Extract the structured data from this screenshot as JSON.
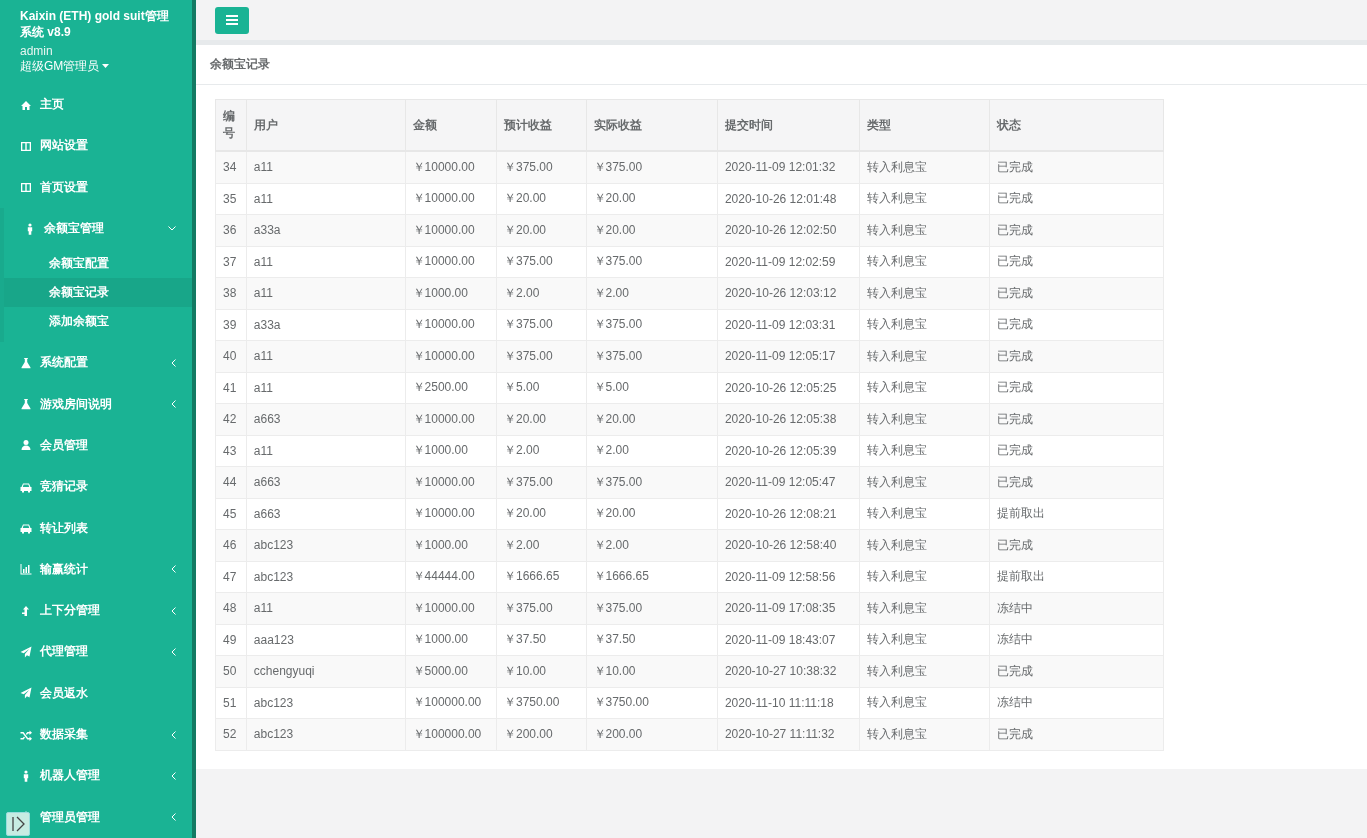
{
  "sidebar": {
    "title": "Kaixin (ETH) gold suit管理系统 v8.9",
    "user": "admin",
    "role": "超级GM管理员",
    "items": [
      {
        "label": "主页"
      },
      {
        "label": "网站设置"
      },
      {
        "label": "首页设置"
      },
      {
        "label": "余额宝管理",
        "expanded": true,
        "children": [
          {
            "label": "余额宝配置",
            "selected": false
          },
          {
            "label": "余额宝记录",
            "selected": true
          },
          {
            "label": "添加余额宝",
            "selected": false
          }
        ]
      },
      {
        "label": "系统配置",
        "expanded": false
      },
      {
        "label": "游戏房间说明",
        "expanded": false
      },
      {
        "label": "会员管理"
      },
      {
        "label": "竞猜记录"
      },
      {
        "label": "转让列表"
      },
      {
        "label": "输赢统计",
        "expanded": false
      },
      {
        "label": "上下分管理",
        "expanded": false
      },
      {
        "label": "代理管理",
        "expanded": false
      },
      {
        "label": "会员返水"
      },
      {
        "label": "数据采集",
        "expanded": false
      },
      {
        "label": "机器人管理",
        "expanded": false
      },
      {
        "label": "管理员管理",
        "expanded": false
      }
    ]
  },
  "panel": {
    "title": "余额宝记录"
  },
  "table": {
    "columns": [
      "编号",
      "用户",
      "金额",
      "预计收益",
      "实际收益",
      "提交时间",
      "类型",
      "状态"
    ],
    "rows": [
      [
        "34",
        "a11",
        "￥10000.00",
        "￥375.00",
        "￥375.00",
        "2020-11-09 12:01:32",
        "转入利息宝",
        "已完成"
      ],
      [
        "35",
        "a11",
        "￥10000.00",
        "￥20.00",
        "￥20.00",
        "2020-10-26 12:01:48",
        "转入利息宝",
        "已完成"
      ],
      [
        "36",
        "a33a",
        "￥10000.00",
        "￥20.00",
        "￥20.00",
        "2020-10-26 12:02:50",
        "转入利息宝",
        "已完成"
      ],
      [
        "37",
        "a11",
        "￥10000.00",
        "￥375.00",
        "￥375.00",
        "2020-11-09 12:02:59",
        "转入利息宝",
        "已完成"
      ],
      [
        "38",
        "a11",
        "￥1000.00",
        "￥2.00",
        "￥2.00",
        "2020-10-26 12:03:12",
        "转入利息宝",
        "已完成"
      ],
      [
        "39",
        "a33a",
        "￥10000.00",
        "￥375.00",
        "￥375.00",
        "2020-11-09 12:03:31",
        "转入利息宝",
        "已完成"
      ],
      [
        "40",
        "a11",
        "￥10000.00",
        "￥375.00",
        "￥375.00",
        "2020-11-09 12:05:17",
        "转入利息宝",
        "已完成"
      ],
      [
        "41",
        "a11",
        "￥2500.00",
        "￥5.00",
        "￥5.00",
        "2020-10-26 12:05:25",
        "转入利息宝",
        "已完成"
      ],
      [
        "42",
        "a663",
        "￥10000.00",
        "￥20.00",
        "￥20.00",
        "2020-10-26 12:05:38",
        "转入利息宝",
        "已完成"
      ],
      [
        "43",
        "a11",
        "￥1000.00",
        "￥2.00",
        "￥2.00",
        "2020-10-26 12:05:39",
        "转入利息宝",
        "已完成"
      ],
      [
        "44",
        "a663",
        "￥10000.00",
        "￥375.00",
        "￥375.00",
        "2020-11-09 12:05:47",
        "转入利息宝",
        "已完成"
      ],
      [
        "45",
        "a663",
        "￥10000.00",
        "￥20.00",
        "￥20.00",
        "2020-10-26 12:08:21",
        "转入利息宝",
        "提前取出"
      ],
      [
        "46",
        "abc123",
        "￥1000.00",
        "￥2.00",
        "￥2.00",
        "2020-10-26 12:58:40",
        "转入利息宝",
        "已完成"
      ],
      [
        "47",
        "abc123",
        "￥44444.00",
        "￥1666.65",
        "￥1666.65",
        "2020-11-09 12:58:56",
        "转入利息宝",
        "提前取出"
      ],
      [
        "48",
        "a11",
        "￥10000.00",
        "￥375.00",
        "￥375.00",
        "2020-11-09 17:08:35",
        "转入利息宝",
        "冻结中"
      ],
      [
        "49",
        "aaa123",
        "￥1000.00",
        "￥37.50",
        "￥37.50",
        "2020-11-09 18:43:07",
        "转入利息宝",
        "冻结中"
      ],
      [
        "50",
        "cchengyuqi",
        "￥5000.00",
        "￥10.00",
        "￥10.00",
        "2020-10-27 10:38:32",
        "转入利息宝",
        "已完成"
      ],
      [
        "51",
        "abc123",
        "￥100000.00",
        "￥3750.00",
        "￥3750.00",
        "2020-11-10 11:11:18",
        "转入利息宝",
        "冻结中"
      ],
      [
        "52",
        "abc123",
        "￥100000.00",
        "￥200.00",
        "￥200.00",
        "2020-10-27 11:11:32",
        "转入利息宝",
        "已完成"
      ]
    ]
  }
}
